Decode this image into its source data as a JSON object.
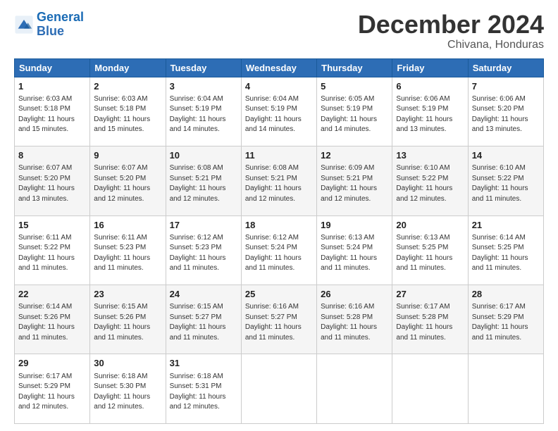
{
  "logo": {
    "text_general": "General",
    "text_blue": "Blue"
  },
  "header": {
    "month": "December 2024",
    "location": "Chivana, Honduras"
  },
  "weekdays": [
    "Sunday",
    "Monday",
    "Tuesday",
    "Wednesday",
    "Thursday",
    "Friday",
    "Saturday"
  ],
  "weeks": [
    [
      {
        "day": "1",
        "sunrise": "6:03 AM",
        "sunset": "5:18 PM",
        "daylight": "11 hours and 15 minutes."
      },
      {
        "day": "2",
        "sunrise": "6:03 AM",
        "sunset": "5:18 PM",
        "daylight": "11 hours and 15 minutes."
      },
      {
        "day": "3",
        "sunrise": "6:04 AM",
        "sunset": "5:19 PM",
        "daylight": "11 hours and 14 minutes."
      },
      {
        "day": "4",
        "sunrise": "6:04 AM",
        "sunset": "5:19 PM",
        "daylight": "11 hours and 14 minutes."
      },
      {
        "day": "5",
        "sunrise": "6:05 AM",
        "sunset": "5:19 PM",
        "daylight": "11 hours and 14 minutes."
      },
      {
        "day": "6",
        "sunrise": "6:06 AM",
        "sunset": "5:19 PM",
        "daylight": "11 hours and 13 minutes."
      },
      {
        "day": "7",
        "sunrise": "6:06 AM",
        "sunset": "5:20 PM",
        "daylight": "11 hours and 13 minutes."
      }
    ],
    [
      {
        "day": "8",
        "sunrise": "6:07 AM",
        "sunset": "5:20 PM",
        "daylight": "11 hours and 13 minutes."
      },
      {
        "day": "9",
        "sunrise": "6:07 AM",
        "sunset": "5:20 PM",
        "daylight": "11 hours and 12 minutes."
      },
      {
        "day": "10",
        "sunrise": "6:08 AM",
        "sunset": "5:21 PM",
        "daylight": "11 hours and 12 minutes."
      },
      {
        "day": "11",
        "sunrise": "6:08 AM",
        "sunset": "5:21 PM",
        "daylight": "11 hours and 12 minutes."
      },
      {
        "day": "12",
        "sunrise": "6:09 AM",
        "sunset": "5:21 PM",
        "daylight": "11 hours and 12 minutes."
      },
      {
        "day": "13",
        "sunrise": "6:10 AM",
        "sunset": "5:22 PM",
        "daylight": "11 hours and 12 minutes."
      },
      {
        "day": "14",
        "sunrise": "6:10 AM",
        "sunset": "5:22 PM",
        "daylight": "11 hours and 11 minutes."
      }
    ],
    [
      {
        "day": "15",
        "sunrise": "6:11 AM",
        "sunset": "5:22 PM",
        "daylight": "11 hours and 11 minutes."
      },
      {
        "day": "16",
        "sunrise": "6:11 AM",
        "sunset": "5:23 PM",
        "daylight": "11 hours and 11 minutes."
      },
      {
        "day": "17",
        "sunrise": "6:12 AM",
        "sunset": "5:23 PM",
        "daylight": "11 hours and 11 minutes."
      },
      {
        "day": "18",
        "sunrise": "6:12 AM",
        "sunset": "5:24 PM",
        "daylight": "11 hours and 11 minutes."
      },
      {
        "day": "19",
        "sunrise": "6:13 AM",
        "sunset": "5:24 PM",
        "daylight": "11 hours and 11 minutes."
      },
      {
        "day": "20",
        "sunrise": "6:13 AM",
        "sunset": "5:25 PM",
        "daylight": "11 hours and 11 minutes."
      },
      {
        "day": "21",
        "sunrise": "6:14 AM",
        "sunset": "5:25 PM",
        "daylight": "11 hours and 11 minutes."
      }
    ],
    [
      {
        "day": "22",
        "sunrise": "6:14 AM",
        "sunset": "5:26 PM",
        "daylight": "11 hours and 11 minutes."
      },
      {
        "day": "23",
        "sunrise": "6:15 AM",
        "sunset": "5:26 PM",
        "daylight": "11 hours and 11 minutes."
      },
      {
        "day": "24",
        "sunrise": "6:15 AM",
        "sunset": "5:27 PM",
        "daylight": "11 hours and 11 minutes."
      },
      {
        "day": "25",
        "sunrise": "6:16 AM",
        "sunset": "5:27 PM",
        "daylight": "11 hours and 11 minutes."
      },
      {
        "day": "26",
        "sunrise": "6:16 AM",
        "sunset": "5:28 PM",
        "daylight": "11 hours and 11 minutes."
      },
      {
        "day": "27",
        "sunrise": "6:17 AM",
        "sunset": "5:28 PM",
        "daylight": "11 hours and 11 minutes."
      },
      {
        "day": "28",
        "sunrise": "6:17 AM",
        "sunset": "5:29 PM",
        "daylight": "11 hours and 11 minutes."
      }
    ],
    [
      {
        "day": "29",
        "sunrise": "6:17 AM",
        "sunset": "5:29 PM",
        "daylight": "11 hours and 12 minutes."
      },
      {
        "day": "30",
        "sunrise": "6:18 AM",
        "sunset": "5:30 PM",
        "daylight": "11 hours and 12 minutes."
      },
      {
        "day": "31",
        "sunrise": "6:18 AM",
        "sunset": "5:31 PM",
        "daylight": "11 hours and 12 minutes."
      },
      null,
      null,
      null,
      null
    ]
  ]
}
